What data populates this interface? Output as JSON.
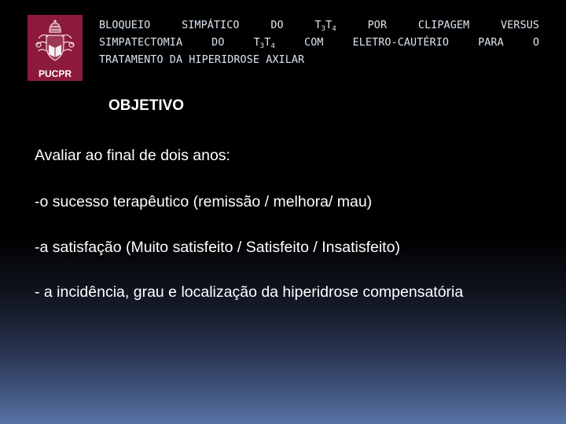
{
  "logo": {
    "text": "PUCPR",
    "icon": "university-crest-icon",
    "background_color": "#8d1a3a"
  },
  "title": {
    "line1": [
      "BLOQUEIO",
      "SIMPÁTICO",
      "DO",
      "T",
      "3",
      "T",
      "4",
      "POR",
      "CLIPAGEM",
      "VERSUS"
    ],
    "line2": [
      "SIMPATECTOMIA",
      "DO",
      "T",
      "3",
      "T",
      "4",
      "COM",
      "ELETRO-CAUTÉRIO",
      "PARA",
      "O"
    ],
    "line3": "TRATAMENTO DA HIPERIDROSE AXILAR",
    "full": "BLOQUEIO SIMPÁTICO DO T3T4 POR CLIPAGEM VERSUS SIMPATECTOMIA DO T3T4 COM ELETRO-CAUTÉRIO PARA O TRATAMENTO DA HIPERIDROSE AXILAR"
  },
  "section": {
    "heading": "OBJETIVO",
    "intro": "Avaliar ao final de dois anos:",
    "items": [
      "-o sucesso terapêutico (remissão / melhora/ mau)",
      "-a satisfação (Muito satisfeito / Satisfeito / Insatisfeito)",
      "- a incidência, grau e localização da hiperidrose compensatória"
    ]
  },
  "colors": {
    "title_text": "#dbe6f0",
    "body_text": "#ffffff",
    "background_top": "#000000",
    "background_bottom": "#5873a5"
  }
}
